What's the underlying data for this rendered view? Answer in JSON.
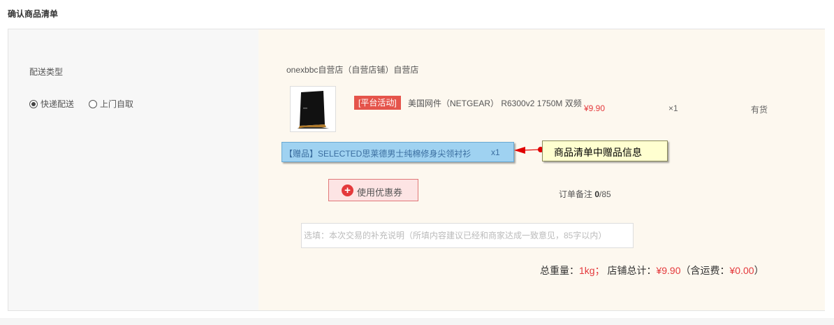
{
  "header": {
    "title": "确认商品清单"
  },
  "delivery": {
    "title": "配送类型",
    "options": [
      {
        "label": "快递配送",
        "checked": true
      },
      {
        "label": "上门自取",
        "checked": false
      }
    ]
  },
  "store": {
    "name": "onexbbc自营店（自营店铺）自营店",
    "product": {
      "tag": "[平台活动]",
      "name": "美国网件（NETGEAR） R6300v2 1750M 双频",
      "price": "¥9.90",
      "quantity": "×1",
      "stock": "有货"
    },
    "gift": {
      "text": "【赠品】SELECTED思莱德男士纯棉修身尖领衬衫",
      "quantity": "x1"
    },
    "annotation": "商品清单中赠品信息"
  },
  "coupon": {
    "label": "使用优惠券"
  },
  "remark": {
    "label": "订单备注",
    "count": "0",
    "max": "/85",
    "placeholder": "选填：本次交易的补充说明（所填内容建议已经和商家达成一致意见，85字以内）"
  },
  "totals": {
    "weight_label": "总重量：",
    "weight": "1kg；",
    "store_total_label": "店铺总计：",
    "store_total": "¥9.90",
    "shipping_prefix": "（含运费：",
    "shipping": "¥0.00",
    "shipping_suffix": "）"
  },
  "colors": {
    "price_red": "#e4393c",
    "tag_bg": "#e5544b",
    "gift_bg": "#9fd2f1",
    "callout_bg": "#ffffd0"
  }
}
